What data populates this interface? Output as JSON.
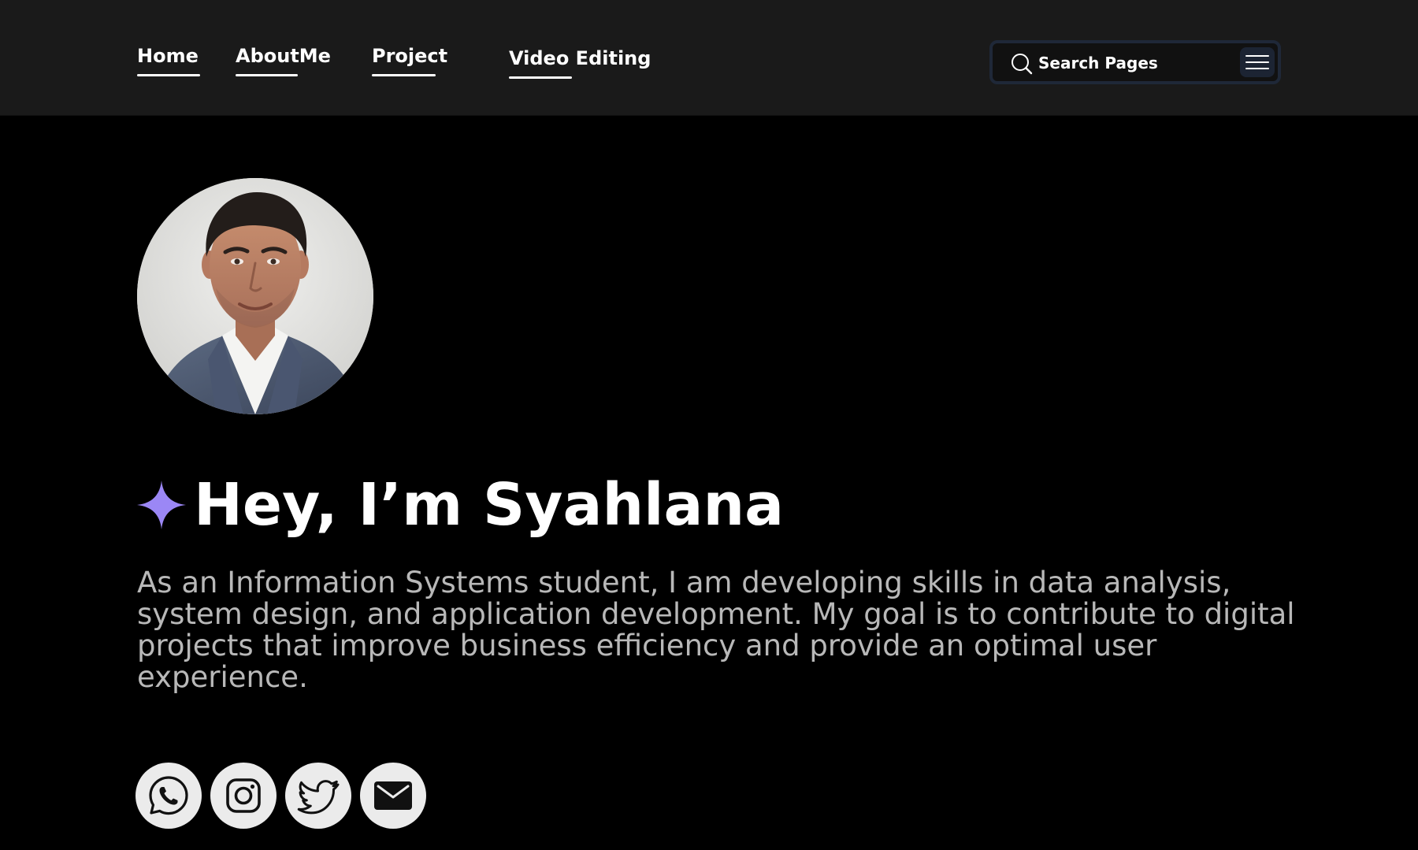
{
  "nav": {
    "home": "Home",
    "about": "AboutMe",
    "project": "Project",
    "video": "Video Editing"
  },
  "search": {
    "label": "Search Pages"
  },
  "hero": {
    "title": "Hey, I’m Syahlana",
    "description": "As an Information Systems student, I am developing skills in data analysis, system design, and application development. My goal is to contribute to digital projects that improve business efficiency and provide an optimal user experience."
  },
  "social": {
    "items": [
      {
        "icon": "whatsapp-icon"
      },
      {
        "icon": "instagram-icon"
      },
      {
        "icon": "twitter-icon"
      },
      {
        "icon": "mail-icon"
      }
    ]
  },
  "colors": {
    "background": "#000000",
    "header": "#1a1a1a",
    "accent": "#9b87f5",
    "text": "#ffffff",
    "muted_text": "#b8b8b8",
    "social_bg": "#ebebeb"
  }
}
